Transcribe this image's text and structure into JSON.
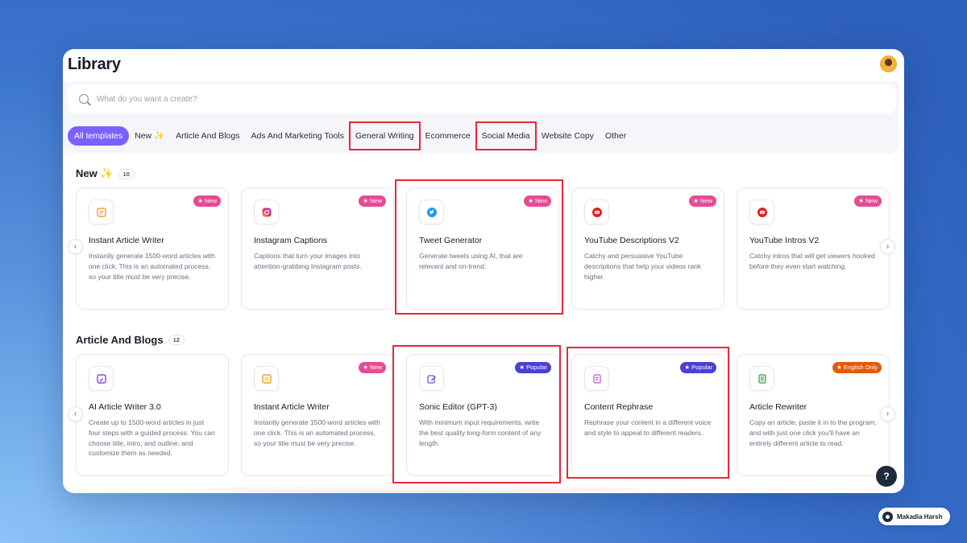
{
  "header": {
    "title": "Library"
  },
  "search": {
    "placeholder": "What do you want a create?"
  },
  "tabs": [
    {
      "label": "All templates"
    },
    {
      "label": "New ✨"
    },
    {
      "label": "Article And Blogs"
    },
    {
      "label": "Ads And Marketing Tools"
    },
    {
      "label": "General Writing"
    },
    {
      "label": "Ecommerce"
    },
    {
      "label": "Social Media"
    },
    {
      "label": "Website Copy"
    },
    {
      "label": "Other"
    }
  ],
  "sections": [
    {
      "title": "New ✨",
      "count": "10",
      "cards": [
        {
          "name": "Instant Article Writer",
          "desc": "Instantly generate 1500-word articles with one click. This is an automated process, so your title must be very precise.",
          "badge": "★ New",
          "icon": "article-icon"
        },
        {
          "name": "Instagram Captions",
          "desc": "Captions that turn your images into attention-grabbing Instagram posts.",
          "badge": "★ New",
          "icon": "instagram-icon"
        },
        {
          "name": "Tweet Generator",
          "desc": "Generate tweets using AI, that are relevant and on-trend.",
          "badge": "★ New",
          "icon": "twitter-icon"
        },
        {
          "name": "YouTube Descriptions V2",
          "desc": "Catchy and persuasive YouTube descriptions that help your videos rank higher.",
          "badge": "★ New",
          "icon": "youtube-icon"
        },
        {
          "name": "YouTube Intros V2",
          "desc": "Catchy intros that will get viewers hooked before they even start watching.",
          "badge": "★ New",
          "icon": "youtube-icon"
        }
      ]
    },
    {
      "title": "Article And Blogs",
      "count": "12",
      "cards": [
        {
          "name": "AI Article Writer 3.0",
          "desc": "Create up to 1500-word articles in just four steps with a guided process. You can choose title, intro, and outline, and customize them as needed.",
          "badge": "",
          "icon": "ai-writer-icon"
        },
        {
          "name": "Instant Article Writer",
          "desc": "Instantly generate 1500-word articles with one click. This is an automated process, so your title must be very precise.",
          "badge": "★ New",
          "icon": "article-icon"
        },
        {
          "name": "Sonic Editor (GPT-3)",
          "desc": "With minimum input requirements, write the best quality long-form content of any length.",
          "badge": "★ Popular",
          "icon": "edit-icon"
        },
        {
          "name": "Content Rephrase",
          "desc": "Rephrase your content in a different voice and style to appeal to different readers.",
          "badge": "★ Popular",
          "icon": "document-icon"
        },
        {
          "name": "Article Rewriter",
          "desc": "Copy an article, paste it in to the program, and with just one click you'll have an entirely different article to read.",
          "badge": "★ English Only",
          "icon": "rewrite-icon"
        }
      ]
    }
  ],
  "help": {
    "label": "?"
  },
  "author": {
    "name": "Makadia Harsh"
  },
  "colors": {
    "accent": "#7b61ff",
    "new": "#e64b93",
    "popular": "#4b3fd8",
    "english": "#e4590b",
    "highlight": "#e8283a"
  }
}
